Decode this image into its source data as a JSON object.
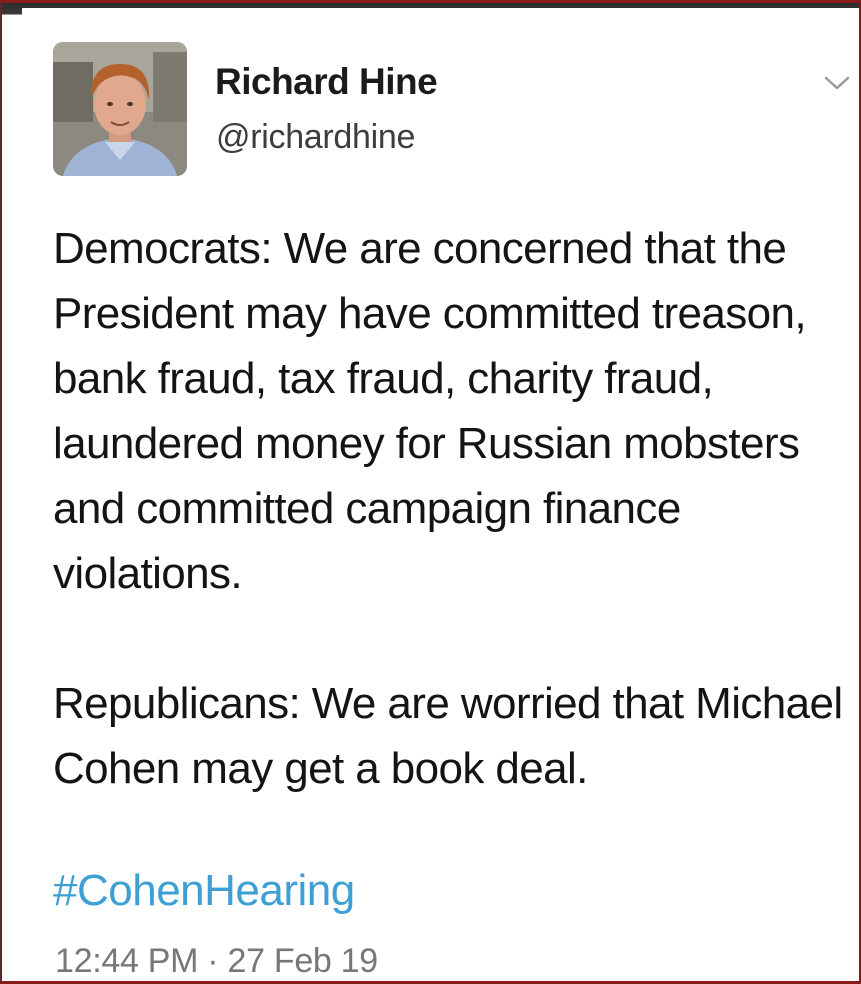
{
  "tweet": {
    "author": {
      "display_name": "Richard Hine",
      "handle": "@richardhine"
    },
    "menu_icon": "chevron-down-icon",
    "body_paragraphs": [
      "Democrats: We are concerned that the President may have committed treason, bank fraud, tax fraud, charity fraud, laundered money for Russian mobsters and committed campaign finance violations.",
      "Republicans: We are worried that Michael Cohen may get a book deal."
    ],
    "hashtag": "#CohenHearing",
    "time": "12:44 PM",
    "separator": "·",
    "date": "27 Feb 19"
  },
  "colors": {
    "hashtag": "#3d9fd3",
    "text": "#141414",
    "muted": "#777777",
    "frame": "#8b1a1a"
  }
}
